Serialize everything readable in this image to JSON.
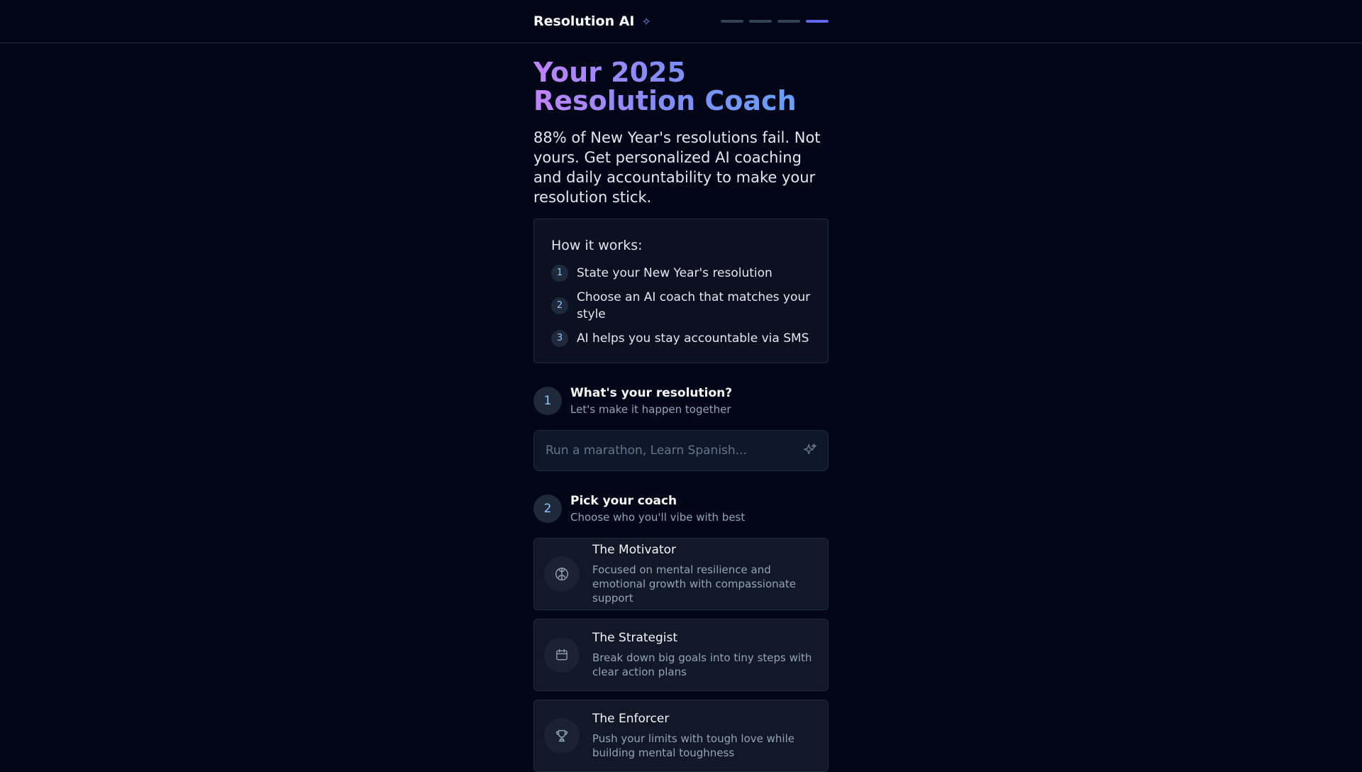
{
  "header": {
    "brand": "Resolution AI",
    "brand_icon": "sparkle-icon",
    "progress": {
      "total": 4,
      "current": 4
    }
  },
  "hero": {
    "title_line1": "Your 2025",
    "title_line2": "Resolution Coach",
    "subtitle": "88% of New Year's resolutions fail. Not yours. Get personalized AI coaching and daily accountability to make your resolution stick."
  },
  "how_it_works": {
    "title": "How it works:",
    "items": [
      {
        "num": "1",
        "text": "State your New Year's resolution"
      },
      {
        "num": "2",
        "text": "Choose an AI coach that matches your style"
      },
      {
        "num": "3",
        "text": "AI helps you stay accountable via SMS"
      }
    ]
  },
  "step1": {
    "num": "1",
    "title": "What's your resolution?",
    "subtitle": "Let's make it happen together",
    "input": {
      "placeholder": "Run a marathon, Learn Spanish...",
      "value": ""
    }
  },
  "step2": {
    "num": "2",
    "title": "Pick your coach",
    "subtitle": "Choose who you'll vibe with best",
    "coaches": [
      {
        "name": "The Motivator",
        "desc": "Focused on mental resilience and emotional growth with compassionate support",
        "icon": "brain-icon"
      },
      {
        "name": "The Strategist",
        "desc": "Break down big goals into tiny steps with clear action plans",
        "icon": "calendar-icon"
      },
      {
        "name": "The Enforcer",
        "desc": "Push your limits with tough love while building mental toughness",
        "icon": "trophy-icon"
      }
    ]
  },
  "colors": {
    "background": "#020617",
    "accent": "#6366f1",
    "gradient_start": "#c084fc",
    "gradient_end": "#60a5fa"
  }
}
